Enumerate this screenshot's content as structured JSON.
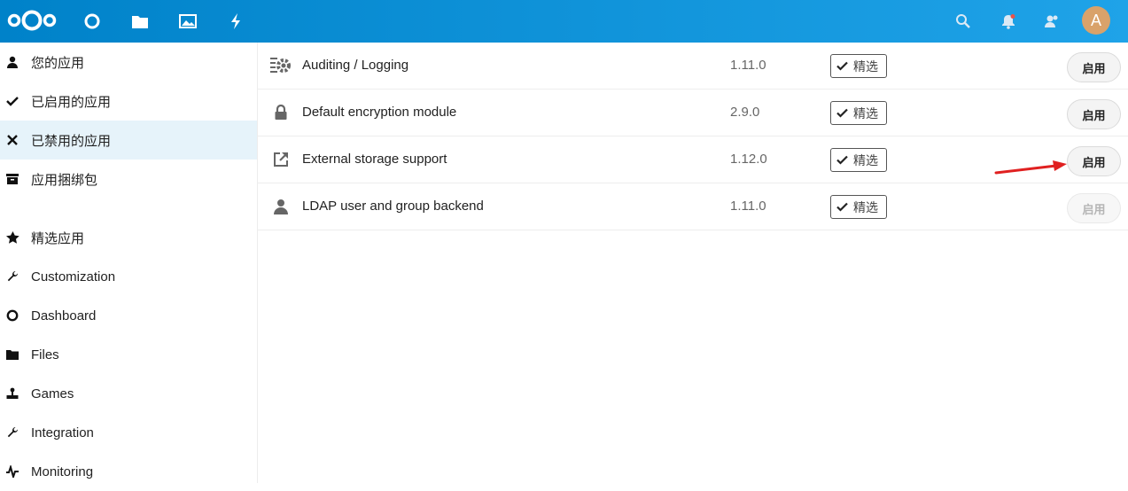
{
  "header": {
    "logo": "nextcloud-logo",
    "apps": [
      {
        "name": "dashboard",
        "icon": "circle-icon"
      },
      {
        "name": "files",
        "icon": "folder-icon"
      },
      {
        "name": "photos",
        "icon": "image-icon"
      },
      {
        "name": "activity",
        "icon": "lightning-icon"
      }
    ],
    "right_icons": [
      "search-icon",
      "notifications-icon",
      "contacts-icon"
    ],
    "avatar_letter": "A",
    "colors": {
      "bar_start": "#0082c9",
      "bar_end": "#1fa3e8",
      "avatar": "#d9a26a"
    }
  },
  "sidebar": {
    "items": [
      {
        "label": "您的应用",
        "icon": "user-icon",
        "active": false
      },
      {
        "label": "已启用的应用",
        "icon": "checkmark-icon",
        "active": false
      },
      {
        "label": "已禁用的应用",
        "icon": "close-icon",
        "active": true
      },
      {
        "label": "应用捆绑包",
        "icon": "archive-icon",
        "active": false
      },
      {
        "label": "精选应用",
        "icon": "star-icon",
        "active": false
      },
      {
        "label": "Customization",
        "icon": "wrench-icon",
        "active": false
      },
      {
        "label": "Dashboard",
        "icon": "circle-icon",
        "active": false
      },
      {
        "label": "Files",
        "icon": "folder-icon",
        "active": false
      },
      {
        "label": "Games",
        "icon": "joystick-icon",
        "active": false
      },
      {
        "label": "Integration",
        "icon": "wrench-icon",
        "active": false
      },
      {
        "label": "Monitoring",
        "icon": "pulse-icon",
        "active": false
      }
    ]
  },
  "apps": [
    {
      "name": "Auditing / Logging",
      "icon": "audit-gear-icon",
      "version": "1.11.0",
      "featured": "精选",
      "action": "启用",
      "enabled": true
    },
    {
      "name": "Default encryption module",
      "icon": "lock-icon",
      "version": "2.9.0",
      "featured": "精选",
      "action": "启用",
      "enabled": true
    },
    {
      "name": "External storage support",
      "icon": "external-link-icon",
      "version": "1.12.0",
      "featured": "精选",
      "action": "启用",
      "enabled": true
    },
    {
      "name": "LDAP user and group backend",
      "icon": "user-icon",
      "version": "1.11.0",
      "featured": "精选",
      "action": "启用",
      "enabled": false
    }
  ],
  "annotation": {
    "color": "#e02020"
  }
}
